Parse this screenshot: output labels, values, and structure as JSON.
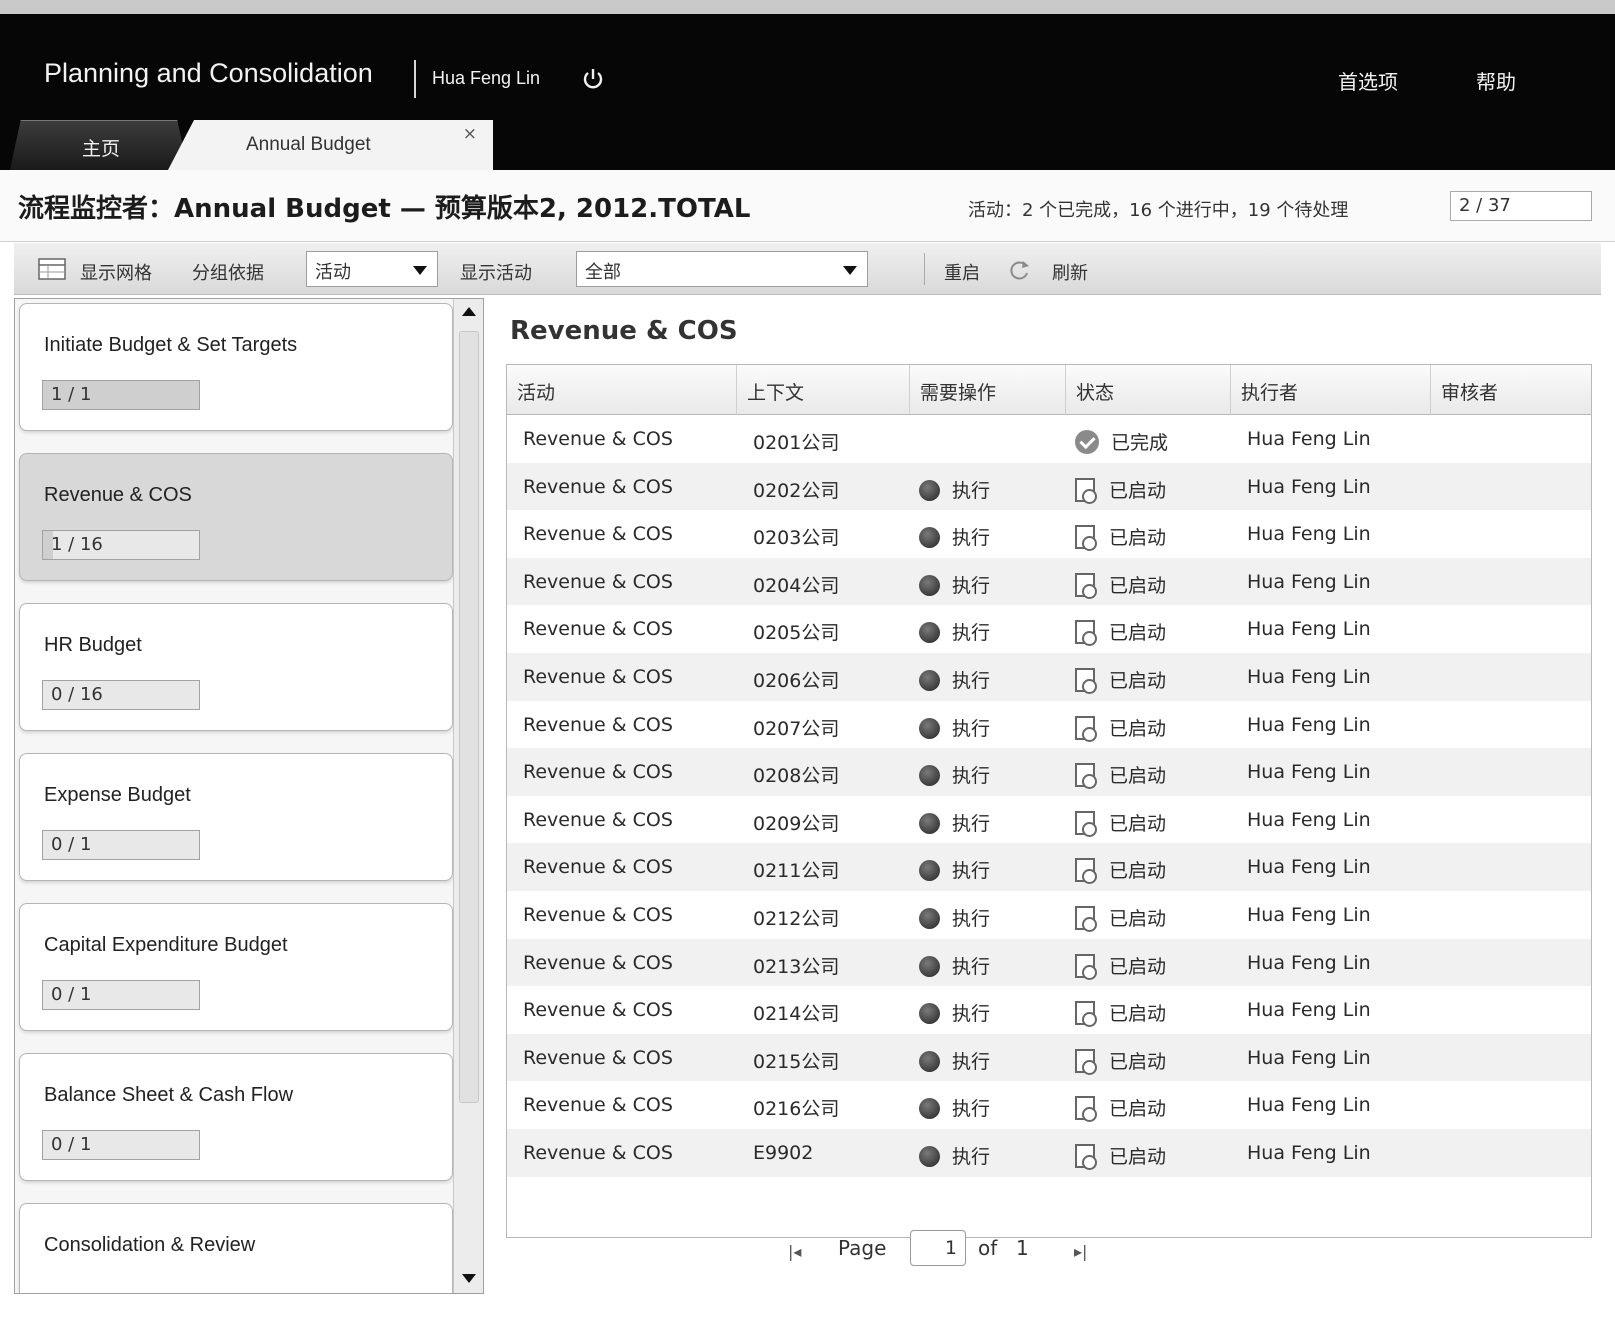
{
  "app": {
    "title": "Planning and Consolidation",
    "user": "Hua Feng Lin",
    "preferences": "首选项",
    "help": "帮助"
  },
  "tabs": {
    "home": "主页",
    "annual": "Annual Budget",
    "close": "×"
  },
  "page": {
    "title": "流程监控者：Annual Budget — 预算版本2, 2012.TOTAL",
    "activity_summary": "活动：2 个已完成，16 个进行中，19 个待处理",
    "counter": "2 / 37"
  },
  "toolbar": {
    "show_grid": "显示网格",
    "group_by_label": "分组依据",
    "group_by_value": "活动",
    "show_activity_label": "显示活动",
    "show_activity_value": "全部",
    "restart": "重启",
    "refresh": "刷新"
  },
  "activities": [
    {
      "title": "Initiate Budget & Set Targets",
      "progress": "1 / 1",
      "fraction": 1.0
    },
    {
      "title": "Revenue & COS",
      "progress": "1 / 16",
      "fraction": 0.0625
    },
    {
      "title": "HR Budget",
      "progress": "0 / 16",
      "fraction": 0
    },
    {
      "title": "Expense Budget",
      "progress": "0 / 1",
      "fraction": 0
    },
    {
      "title": "Capital Expenditure Budget",
      "progress": "0 / 1",
      "fraction": 0
    },
    {
      "title": "Balance Sheet & Cash Flow",
      "progress": "0 / 1",
      "fraction": 0
    },
    {
      "title": "Consolidation & Review",
      "progress": "",
      "fraction": 0
    }
  ],
  "detail": {
    "section_title": "Revenue & COS",
    "columns": [
      "活动",
      "上下文",
      "需要操作",
      "状态",
      "执行者",
      "审核者"
    ],
    "rows": [
      {
        "activity": "Revenue & COS",
        "context": "0201公司",
        "action": "",
        "status": "已完成",
        "status_icon": "check-icon",
        "executor": "Hua Feng Lin",
        "reviewer": ""
      },
      {
        "activity": "Revenue & COS",
        "context": "0202公司",
        "action": "执行",
        "status": "已启动",
        "status_icon": "doc-icon",
        "executor": "Hua Feng Lin",
        "reviewer": ""
      },
      {
        "activity": "Revenue & COS",
        "context": "0203公司",
        "action": "执行",
        "status": "已启动",
        "status_icon": "doc-icon",
        "executor": "Hua Feng Lin",
        "reviewer": ""
      },
      {
        "activity": "Revenue & COS",
        "context": "0204公司",
        "action": "执行",
        "status": "已启动",
        "status_icon": "doc-icon",
        "executor": "Hua Feng Lin",
        "reviewer": ""
      },
      {
        "activity": "Revenue & COS",
        "context": "0205公司",
        "action": "执行",
        "status": "已启动",
        "status_icon": "doc-icon",
        "executor": "Hua Feng Lin",
        "reviewer": ""
      },
      {
        "activity": "Revenue & COS",
        "context": "0206公司",
        "action": "执行",
        "status": "已启动",
        "status_icon": "doc-icon",
        "executor": "Hua Feng Lin",
        "reviewer": ""
      },
      {
        "activity": "Revenue & COS",
        "context": "0207公司",
        "action": "执行",
        "status": "已启动",
        "status_icon": "doc-icon",
        "executor": "Hua Feng Lin",
        "reviewer": ""
      },
      {
        "activity": "Revenue & COS",
        "context": "0208公司",
        "action": "执行",
        "status": "已启动",
        "status_icon": "doc-icon",
        "executor": "Hua Feng Lin",
        "reviewer": ""
      },
      {
        "activity": "Revenue & COS",
        "context": "0209公司",
        "action": "执行",
        "status": "已启动",
        "status_icon": "doc-icon",
        "executor": "Hua Feng Lin",
        "reviewer": ""
      },
      {
        "activity": "Revenue & COS",
        "context": "0211公司",
        "action": "执行",
        "status": "已启动",
        "status_icon": "doc-icon",
        "executor": "Hua Feng Lin",
        "reviewer": ""
      },
      {
        "activity": "Revenue & COS",
        "context": "0212公司",
        "action": "执行",
        "status": "已启动",
        "status_icon": "doc-icon",
        "executor": "Hua Feng Lin",
        "reviewer": ""
      },
      {
        "activity": "Revenue & COS",
        "context": "0213公司",
        "action": "执行",
        "status": "已启动",
        "status_icon": "doc-icon",
        "executor": "Hua Feng Lin",
        "reviewer": ""
      },
      {
        "activity": "Revenue & COS",
        "context": "0214公司",
        "action": "执行",
        "status": "已启动",
        "status_icon": "doc-icon",
        "executor": "Hua Feng Lin",
        "reviewer": ""
      },
      {
        "activity": "Revenue & COS",
        "context": "0215公司",
        "action": "执行",
        "status": "已启动",
        "status_icon": "doc-icon",
        "executor": "Hua Feng Lin",
        "reviewer": ""
      },
      {
        "activity": "Revenue & COS",
        "context": "0216公司",
        "action": "执行",
        "status": "已启动",
        "status_icon": "doc-icon",
        "executor": "Hua Feng Lin",
        "reviewer": ""
      },
      {
        "activity": "Revenue & COS",
        "context": "E9902",
        "action": "执行",
        "status": "已启动",
        "status_icon": "doc-icon",
        "executor": "Hua Feng Lin",
        "reviewer": ""
      }
    ]
  },
  "pager": {
    "page_label": "Page",
    "current": "1",
    "of_label": "of",
    "total": "1"
  }
}
